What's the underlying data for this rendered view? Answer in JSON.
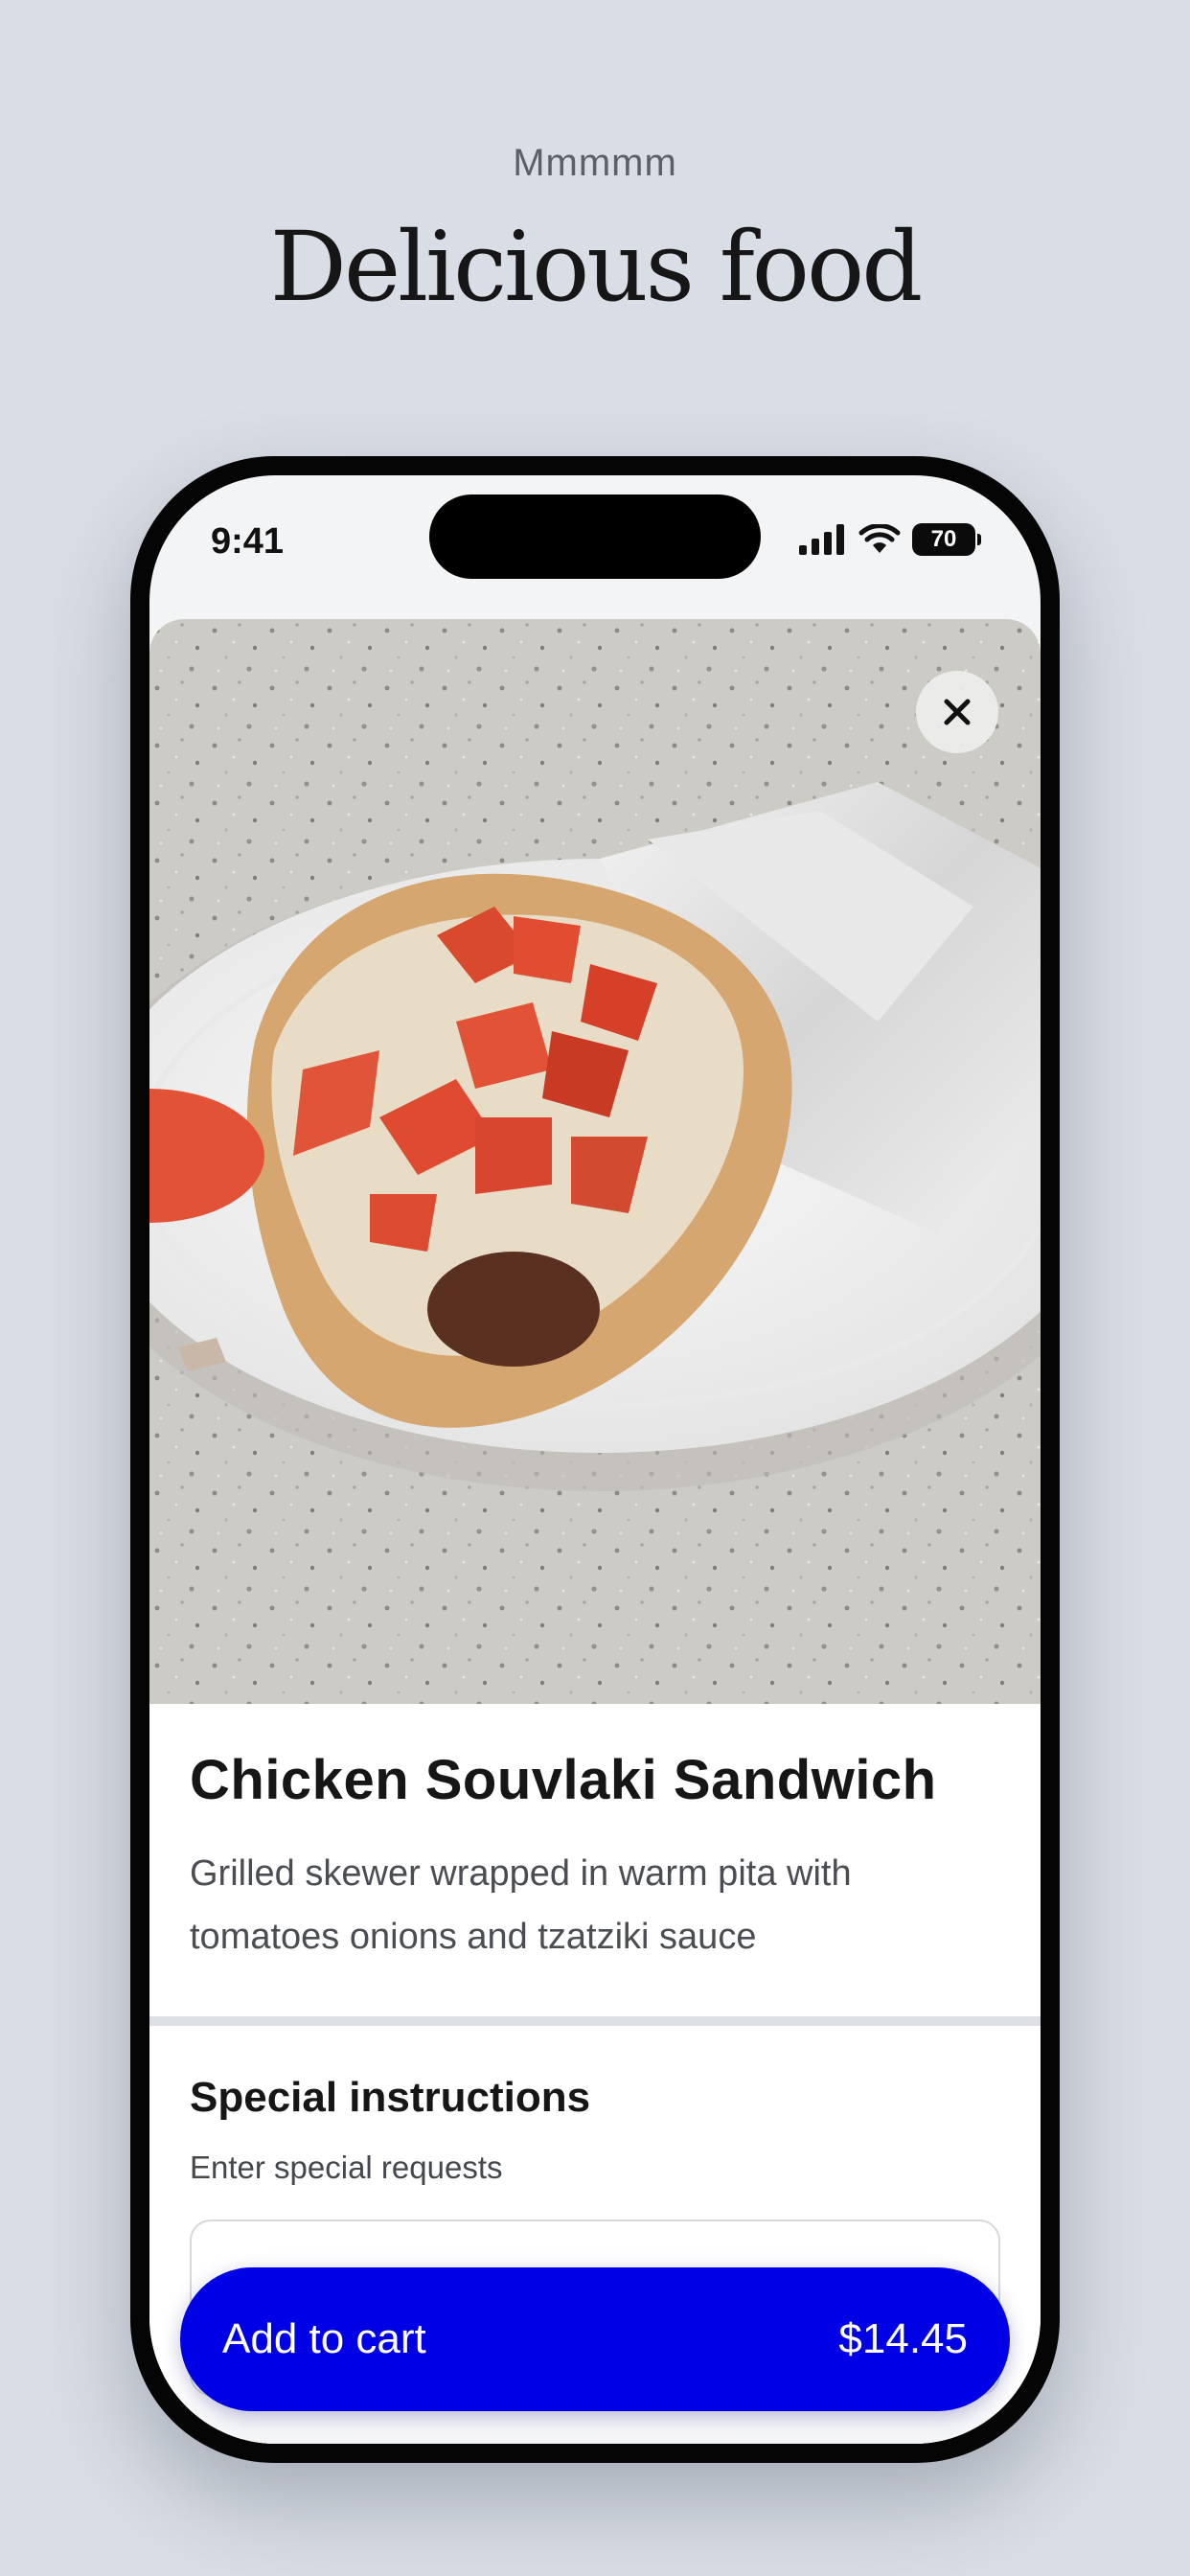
{
  "promo": {
    "kicker": "Mmmmm",
    "headline": "Delicious food"
  },
  "status_bar": {
    "time": "9:41",
    "battery": "70",
    "icons": [
      "signal-icon",
      "wifi-icon",
      "battery-icon"
    ]
  },
  "item": {
    "photo": "chicken-souvlaki-photo",
    "title": "Chicken Souvlaki Sandwich",
    "description": "Grilled skewer wrapped in warm pita with tomatoes onions and tzatziki sauce"
  },
  "special_instructions": {
    "title": "Special instructions",
    "subtitle": "Enter special requests",
    "value": ""
  },
  "cart_button": {
    "label": "Add to cart",
    "price": "$14.45"
  },
  "colors": {
    "accent": "#0000e6",
    "background": "#d9dde5"
  }
}
